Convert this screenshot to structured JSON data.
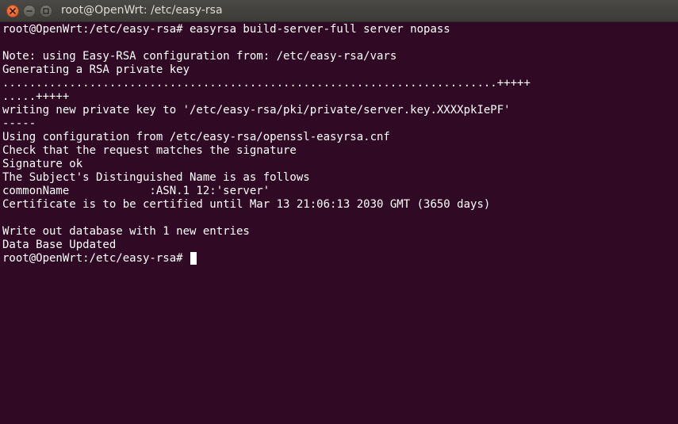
{
  "window": {
    "title": "root@OpenWrt: /etc/easy-rsa"
  },
  "terminal": {
    "lines": [
      "root@OpenWrt:/etc/easy-rsa# easyrsa build-server-full server nopass",
      "",
      "Note: using Easy-RSA configuration from: /etc/easy-rsa/vars",
      "Generating a RSA private key",
      "..........................................................................+++++",
      ".....+++++",
      "writing new private key to '/etc/easy-rsa/pki/private/server.key.XXXXpkIePF'",
      "-----",
      "Using configuration from /etc/easy-rsa/openssl-easyrsa.cnf",
      "Check that the request matches the signature",
      "Signature ok",
      "The Subject's Distinguished Name is as follows",
      "commonName            :ASN.1 12:'server'",
      "Certificate is to be certified until Mar 13 21:06:13 2030 GMT (3650 days)",
      "",
      "Write out database with 1 new entries",
      "Data Base Updated"
    ],
    "prompt": "root@OpenWrt:/etc/easy-rsa# "
  },
  "colors": {
    "background": "#300a24",
    "foreground": "#ffffff",
    "close_button": "#e95420"
  },
  "icons": [
    "close-icon",
    "minimize-icon",
    "maximize-icon"
  ]
}
